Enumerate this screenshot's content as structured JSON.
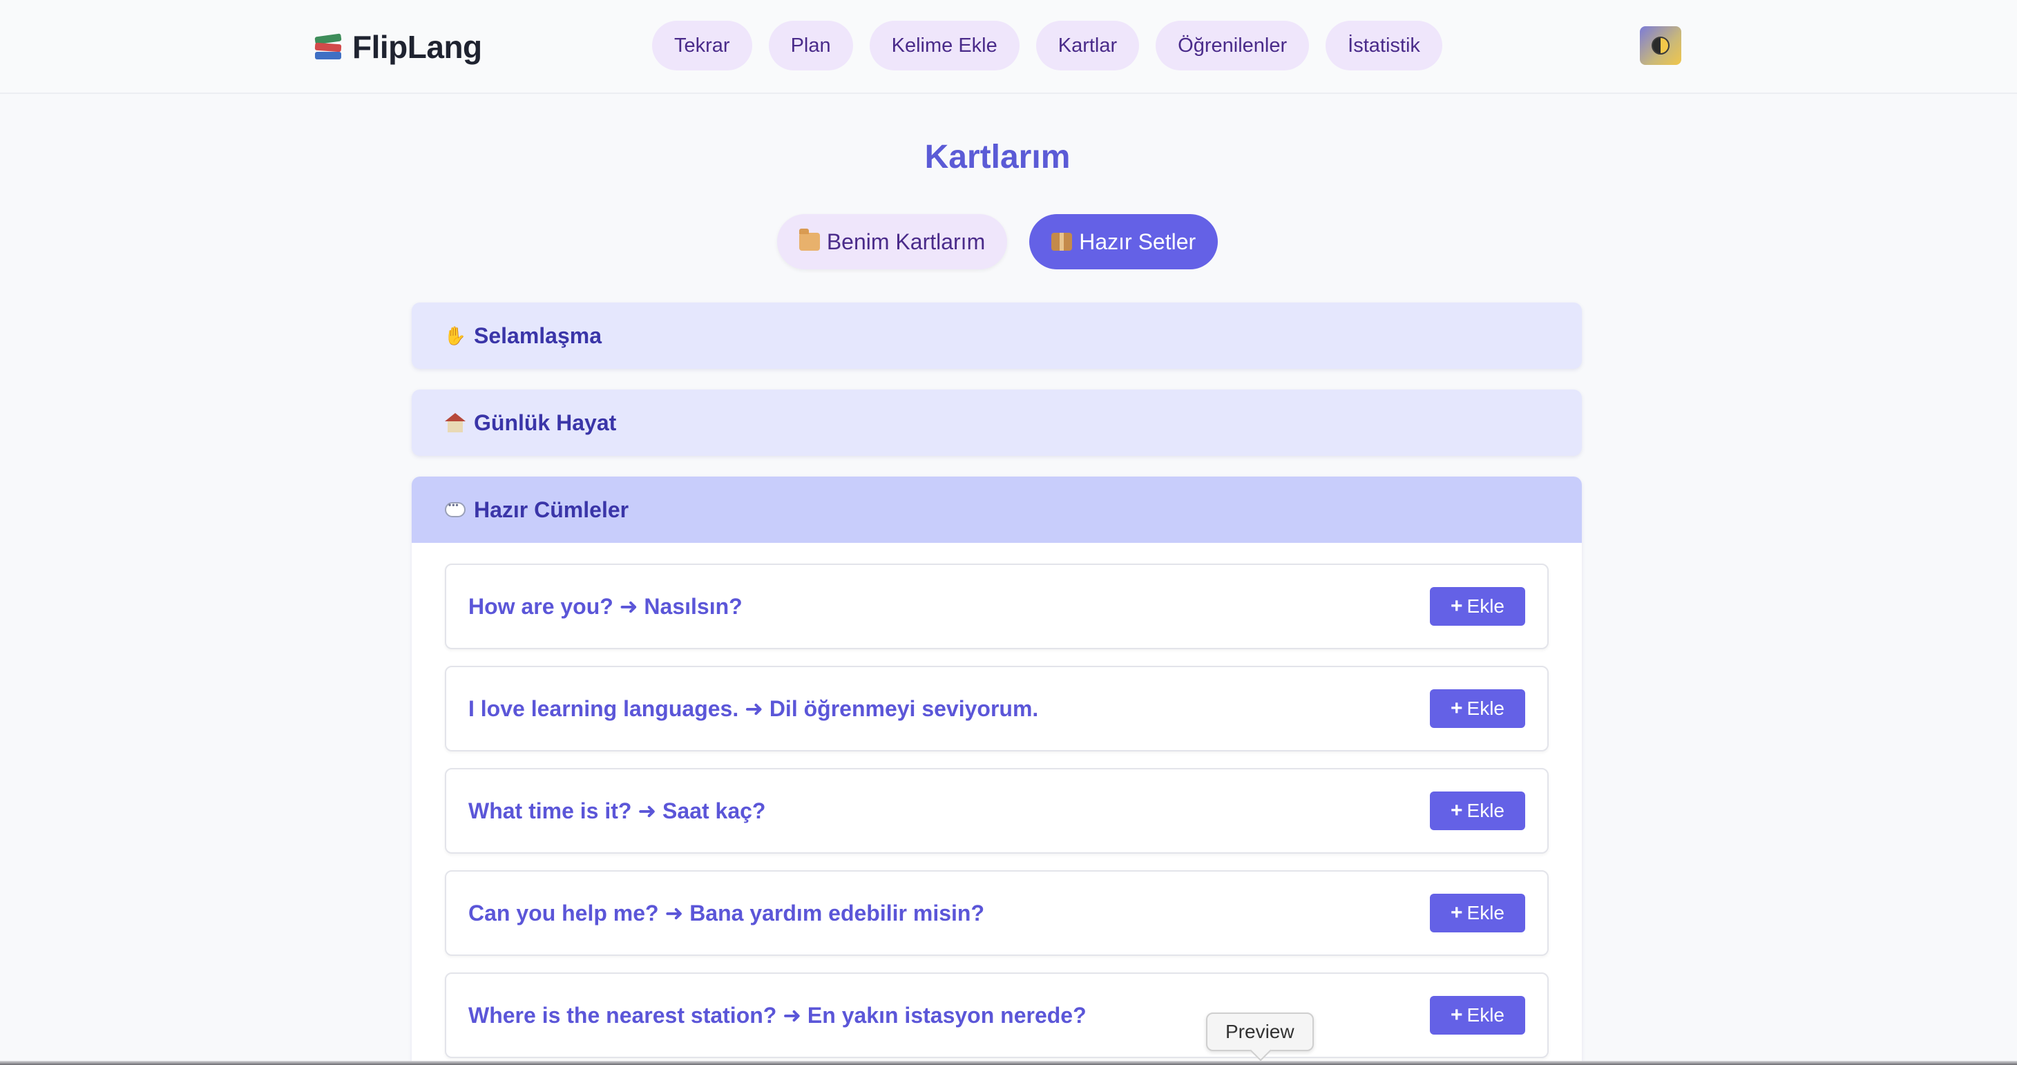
{
  "app": {
    "name": "FlipLang"
  },
  "nav": {
    "items": [
      "Tekrar",
      "Plan",
      "Kelime Ekle",
      "Kartlar",
      "Öğrenilenler",
      "İstatistik"
    ]
  },
  "page": {
    "title": "Kartlarım"
  },
  "tabs": [
    {
      "label": "Benim Kartlarım",
      "icon": "folder-icon",
      "active": false
    },
    {
      "label": "Hazır Setler",
      "icon": "package-icon",
      "active": true
    }
  ],
  "sets": [
    {
      "title": "Selamlaşma",
      "icon": "waving-hand-icon",
      "open": false
    },
    {
      "title": "Günlük Hayat",
      "icon": "house-icon",
      "open": false
    },
    {
      "title": "Hazır Cümleler",
      "icon": "speech-bubble-icon",
      "open": true
    }
  ],
  "phrases": [
    {
      "text": "How are you? ➜ Nasılsın?",
      "button": "Ekle"
    },
    {
      "text": "I love learning languages. ➜ Dil öğrenmeyi seviyorum.",
      "button": "Ekle"
    },
    {
      "text": "What time is it? ➜ Saat kaç?",
      "button": "Ekle"
    },
    {
      "text": "Can you help me? ➜ Bana yardım edebilir misin?",
      "button": "Ekle"
    },
    {
      "text": "Where is the nearest station? ➜ En yakın istasyon nerede?",
      "button": "Ekle"
    }
  ],
  "tooltip": {
    "text": "Preview"
  },
  "colors": {
    "accent": "#6461e6",
    "pill": "#efe6fb",
    "set_bg": "#e5e7fd",
    "set_open": "#c8cdfb",
    "phrase_text": "#5b56d8"
  }
}
